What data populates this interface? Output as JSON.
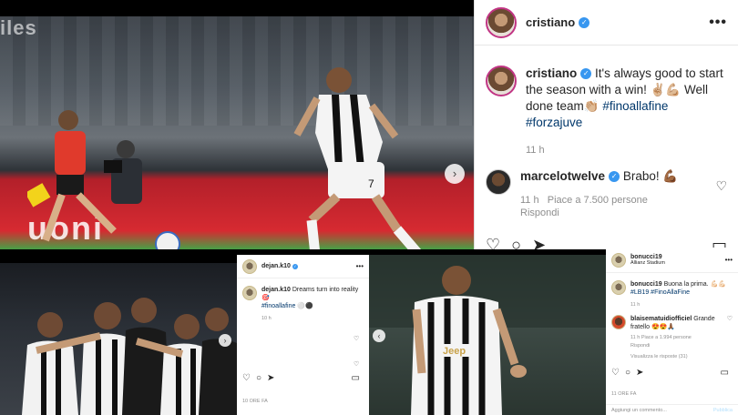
{
  "top_photo": {
    "ad_text_bottom": "uoni",
    "ad_text_top": "iles",
    "next_arrow": "›",
    "player_number": "7"
  },
  "ig_post": {
    "username": "cristiano",
    "more": "•••",
    "caption": {
      "username": "cristiano",
      "text": "It's always good to start the season with a win! ✌🏼💪🏼 Well done team👏🏼",
      "hashtag1": "#finoallafine",
      "hashtag2": "#forzajuve",
      "time": "11 h"
    },
    "comment": {
      "username": "marcelotwelve",
      "text": "Brabo! 💪🏾",
      "time": "11 h",
      "likes": "Piace a 7.500 persone",
      "reply": "Rispondi"
    }
  },
  "dejan_panel": {
    "username": "dejan.k10",
    "caption_username": "dejan.k10",
    "caption_text": "Dreams turn into reality 🎯",
    "hashtag": "#finoallafine",
    "time": "10 h",
    "footer": "10 ORE FA"
  },
  "bonucci_panel": {
    "username": "bonucci19",
    "location": "Allianz Stadium",
    "caption_username": "bonucci19",
    "caption_text": "Buona la prima. 💪🏻💪🏻",
    "hashtags": "#LB19 #FinoAllaFine",
    "time": "11 h",
    "comment_username": "blaisematuidiofficiel",
    "comment_text": "Grande fratello 😍😍🙏🏾",
    "comment_time": "11 h",
    "comment_likes": "Piace a 1.994 persone",
    "comment_reply": "Rispondi",
    "view_replies": "Visualizza le risposte (31)",
    "footer": "11 ORE FA",
    "add_comment": "Aggiungi un commento...",
    "publish": "Pubblica"
  },
  "bottom_photo_right": {
    "sponsor": "Jeep"
  },
  "colors": {
    "verified": "#3897f0",
    "hashtag": "#00376b",
    "juve_black": "#111111",
    "juve_white": "#f4f4f4",
    "pitch_red": "#d62a31"
  }
}
